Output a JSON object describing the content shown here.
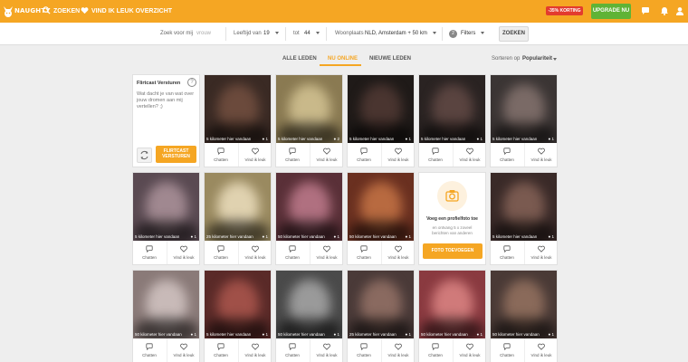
{
  "header": {
    "logo_text": "NAUGHTY",
    "nav": [
      {
        "label": "ZOEKEN",
        "icon": "search-icon"
      },
      {
        "label": "VIND IK LEUK OVERZICHT",
        "icon": "heart-icon"
      }
    ],
    "promo_badge": "-35% KORTING",
    "upgrade_label": "UPGRADE NU",
    "colors": {
      "brand": "#f5a623",
      "upgrade": "#5fb336",
      "promo": "#e33b2e"
    }
  },
  "search": {
    "name_label": "Zoek voor mij",
    "name_placeholder": "vrouw",
    "age_label": "Leeftijd van",
    "age_from": "19",
    "age_to_label": "tot",
    "age_to": "44",
    "location_label": "Woonplaats",
    "location_value": "NLD, Amsterdam + 50 km",
    "filters_count": "2",
    "filters_label": "Filters",
    "submit_label": "ZOEKEN"
  },
  "tabs": [
    {
      "label": "ALLE LEDEN",
      "active": false
    },
    {
      "label": "NU ONLINE",
      "active": true
    },
    {
      "label": "NIEUWE LEDEN",
      "active": false
    }
  ],
  "sort": {
    "label": "Sorteren op",
    "value": "Populariteit"
  },
  "flirtcast": {
    "title": "Flirtcast Versturen",
    "help": "?",
    "text": "Wat dacht je van wat over jouw dromen aan mij vertellen? ;)",
    "send_label": "FLIRTCAST VERSTUREN"
  },
  "add_photo": {
    "title": "Voeg een profielfoto toe",
    "text": "en ontvang 5 x zoveel berichten van anderen",
    "button": "FOTO TOEVOEGEN"
  },
  "card_actions": {
    "chat": "Chatten",
    "like": "Vind ik leuk"
  },
  "profiles": [
    {
      "distance": "5 kilometer hier vandaan",
      "photos": "1",
      "colors": [
        "#3a2a24",
        "#6b4a3c"
      ]
    },
    {
      "distance": "5 kilometer hier vandaan",
      "photos": "2",
      "colors": [
        "#8a7a52",
        "#c9b98a"
      ]
    },
    {
      "distance": "5 kilometer hier vandaan",
      "photos": "1",
      "colors": [
        "#1f1a18",
        "#4a3530"
      ]
    },
    {
      "distance": "5 kilometer hier vandaan",
      "photos": "1",
      "colors": [
        "#2a2322",
        "#5a4440"
      ]
    },
    {
      "distance": "5 kilometer hier vandaan",
      "photos": "1",
      "colors": [
        "#3b3534",
        "#7a6a66"
      ]
    },
    {
      "distance": "5 kilometer hier vandaan",
      "photos": "1",
      "colors": [
        "#5a4a52",
        "#a08890"
      ]
    },
    {
      "distance": "25 kilometer hier vandaan",
      "photos": "1",
      "colors": [
        "#9a8a60",
        "#e0d2b0"
      ]
    },
    {
      "distance": "50 kilometer hier vandaan",
      "photos": "1",
      "colors": [
        "#5a3038",
        "#b07080"
      ]
    },
    {
      "distance": "50 kilometer hier vandaan",
      "photos": "1",
      "colors": [
        "#6a3020",
        "#b86a40"
      ]
    },
    {
      "distance": "5 kilometer hier vandaan",
      "photos": "1",
      "colors": [
        "#3a2a28",
        "#7a5a50"
      ]
    },
    {
      "distance": "50 kilometer hier vandaan",
      "photos": "1",
      "colors": [
        "#8a7a78",
        "#c8bab8"
      ]
    },
    {
      "distance": "5 kilometer hier vandaan",
      "photos": "1",
      "colors": [
        "#5a2a28",
        "#a05048"
      ]
    },
    {
      "distance": "50 kilometer hier vandaan",
      "photos": "1",
      "colors": [
        "#4a4a4a",
        "#9a9a9a"
      ]
    },
    {
      "distance": "25 kilometer hier vandaan",
      "photos": "1",
      "colors": [
        "#4a3a38",
        "#8a6a60"
      ]
    },
    {
      "distance": "50 kilometer hier vandaan",
      "photos": "1",
      "colors": [
        "#8a3a40",
        "#d07a7a"
      ]
    },
    {
      "distance": "50 kilometer hier vandaan",
      "photos": "1",
      "colors": [
        "#4a3a36",
        "#8a6a5a"
      ]
    }
  ]
}
